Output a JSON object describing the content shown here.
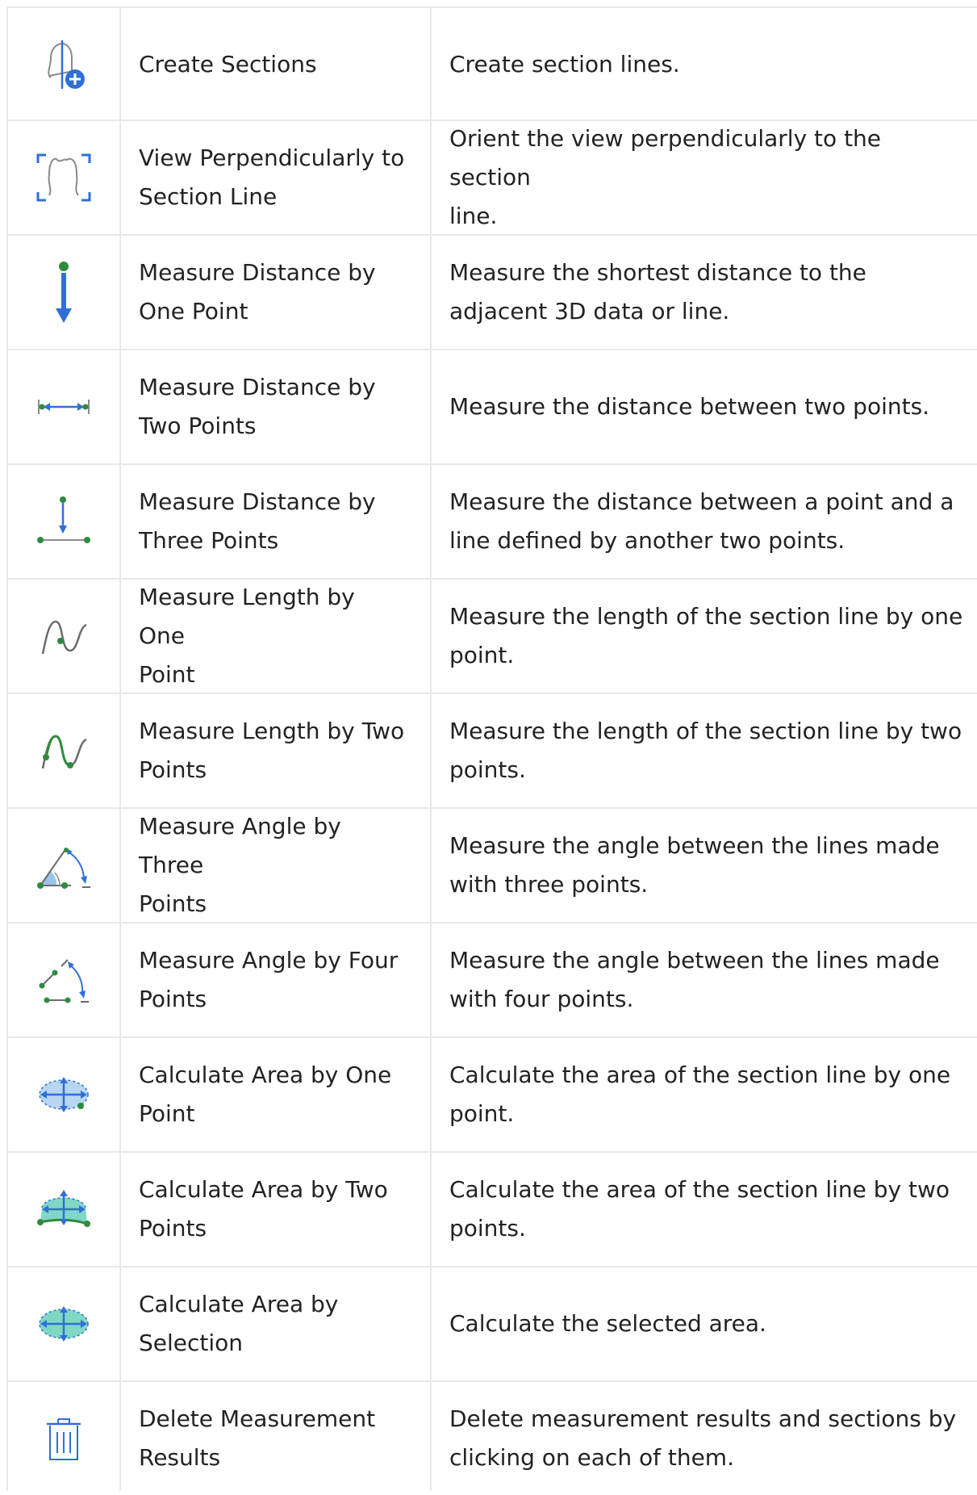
{
  "colors": {
    "border": "#e8e8e8",
    "text": "#222222",
    "blue": "#2f6fd6",
    "green": "#2e8b3e",
    "gray": "#6b6b6b"
  },
  "rows": [
    {
      "icon": "create-sections-icon",
      "name": "Create Sections",
      "desc": "Create section lines."
    },
    {
      "icon": "view-perpendicular-icon",
      "name": "View Perpendicularly to\nSection Line",
      "desc": "Orient the view perpendicularly to the section\nline."
    },
    {
      "icon": "distance-one-point-icon",
      "name": "Measure Distance by\nOne Point",
      "desc": "Measure the shortest distance to the\nadjacent 3D data or line."
    },
    {
      "icon": "distance-two-points-icon",
      "name": "Measure Distance by\nTwo Points",
      "desc": "Measure the distance between two points."
    },
    {
      "icon": "distance-three-points-icon",
      "name": "Measure Distance by\nThree Points",
      "desc": "Measure the distance between a point and a\nline defined by another two points."
    },
    {
      "icon": "length-one-point-icon",
      "name": "Measure Length by One\nPoint",
      "desc": "Measure the length of the section line by one\npoint."
    },
    {
      "icon": "length-two-points-icon",
      "name": "Measure Length by Two\nPoints",
      "desc": "Measure the length of the section line by two\npoints."
    },
    {
      "icon": "angle-three-points-icon",
      "name": "Measure Angle by Three\nPoints",
      "desc": "Measure the angle between the lines made\nwith three points."
    },
    {
      "icon": "angle-four-points-icon",
      "name": "Measure Angle by Four\nPoints",
      "desc": "Measure the angle between the lines made\nwith four points."
    },
    {
      "icon": "area-one-point-icon",
      "name": "Calculate Area by One\nPoint",
      "desc": "Calculate the area of the section line by one\npoint."
    },
    {
      "icon": "area-two-points-icon",
      "name": "Calculate Area by Two\nPoints",
      "desc": "Calculate the area of the section line by two\npoints."
    },
    {
      "icon": "area-selection-icon",
      "name": "Calculate Area by\nSelection",
      "desc": "Calculate the selected area."
    },
    {
      "icon": "trash-icon",
      "name": "Delete Measurement\nResults",
      "desc": "Delete measurement results and sections by\nclicking on each of them."
    }
  ]
}
